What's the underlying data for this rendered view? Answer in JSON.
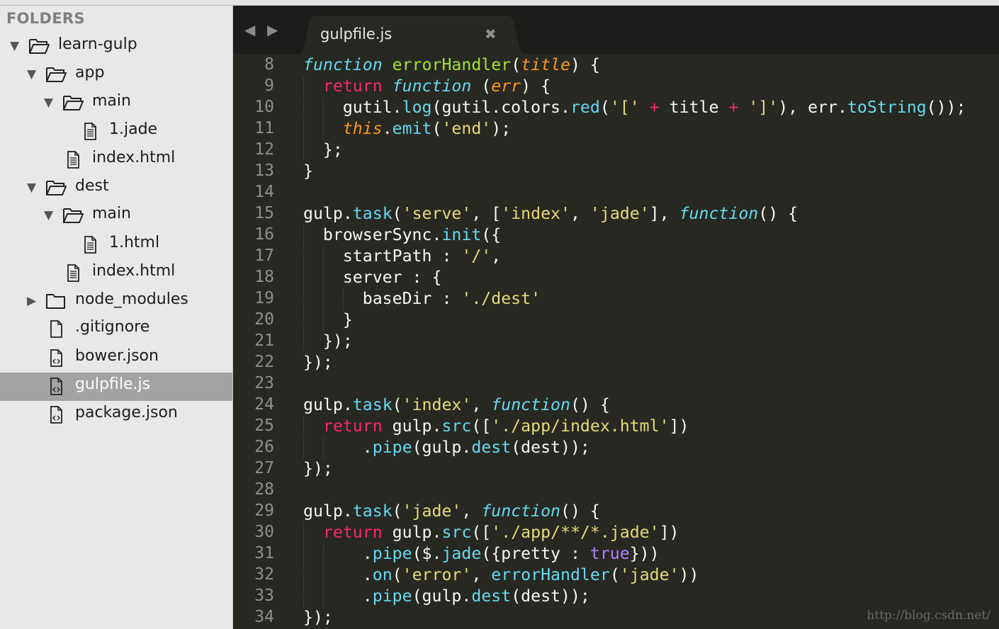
{
  "sidebar": {
    "title": "FOLDERS",
    "items": [
      {
        "label": "learn-gulp",
        "arrow": "▼",
        "icon": "folder-open-icon"
      },
      {
        "label": "app",
        "arrow": "▼",
        "icon": "folder-open-icon"
      },
      {
        "label": "main",
        "arrow": "▼",
        "icon": "folder-open-icon"
      },
      {
        "label": "1.jade",
        "arrow": "",
        "icon": "text-file-icon"
      },
      {
        "label": "index.html",
        "arrow": "",
        "icon": "text-file-icon"
      },
      {
        "label": "dest",
        "arrow": "▼",
        "icon": "folder-open-icon"
      },
      {
        "label": "main",
        "arrow": "▼",
        "icon": "folder-open-icon"
      },
      {
        "label": "1.html",
        "arrow": "",
        "icon": "text-file-icon"
      },
      {
        "label": "index.html",
        "arrow": "",
        "icon": "text-file-icon"
      },
      {
        "label": "node_modules",
        "arrow": "▶",
        "icon": "folder-closed-icon"
      },
      {
        "label": ".gitignore",
        "arrow": "",
        "icon": "blank-file-icon"
      },
      {
        "label": "bower.json",
        "arrow": "",
        "icon": "code-file-icon"
      },
      {
        "label": "gulpfile.js",
        "arrow": "",
        "icon": "code-file-icon",
        "selected": true
      },
      {
        "label": "package.json",
        "arrow": "",
        "icon": "code-file-icon"
      }
    ]
  },
  "tabbar": {
    "back_arrow": "◀",
    "forward_arrow": "▶",
    "tab_label": "gulpfile.js",
    "tab_close": "✖"
  },
  "editor": {
    "theme": {
      "background": "#272822",
      "storage": "#66d9ef",
      "entity": "#a6e22e",
      "parameter": "#fd971f",
      "keyword": "#f92672",
      "string": "#e6db74",
      "constant": "#ae81ff"
    },
    "line_numbers": [
      "8",
      "9",
      "10",
      "11",
      "12",
      "13",
      "14",
      "15",
      "16",
      "17",
      "18",
      "19",
      "20",
      "21",
      "22",
      "23",
      "24",
      "25",
      "26",
      "27",
      "28",
      "29",
      "30",
      "31",
      "32",
      "33",
      "34"
    ],
    "lines": [
      [
        {
          "t": "function",
          "c": "storage"
        },
        {
          "t": " "
        },
        {
          "t": "errorHandler",
          "c": "entity"
        },
        {
          "t": "("
        },
        {
          "t": "title",
          "c": "param"
        },
        {
          "t": ") {"
        }
      ],
      [
        {
          "t": "  "
        },
        {
          "t": "return",
          "c": "keyword"
        },
        {
          "t": " "
        },
        {
          "t": "function",
          "c": "storage"
        },
        {
          "t": " ("
        },
        {
          "t": "err",
          "c": "param"
        },
        {
          "t": ") {"
        }
      ],
      [
        {
          "t": "    gutil."
        },
        {
          "t": "log",
          "c": "support"
        },
        {
          "t": "(gutil.colors."
        },
        {
          "t": "red",
          "c": "support"
        },
        {
          "t": "("
        },
        {
          "t": "'['",
          "c": "string"
        },
        {
          "t": " "
        },
        {
          "t": "+",
          "c": "keyword"
        },
        {
          "t": " title "
        },
        {
          "t": "+",
          "c": "keyword"
        },
        {
          "t": " "
        },
        {
          "t": "']'",
          "c": "string"
        },
        {
          "t": "), err."
        },
        {
          "t": "toString",
          "c": "support"
        },
        {
          "t": "());"
        }
      ],
      [
        {
          "t": "    "
        },
        {
          "t": "this",
          "c": "param"
        },
        {
          "t": "."
        },
        {
          "t": "emit",
          "c": "support"
        },
        {
          "t": "("
        },
        {
          "t": "'end'",
          "c": "string"
        },
        {
          "t": ");"
        }
      ],
      [
        {
          "t": "  };"
        }
      ],
      [
        {
          "t": "}"
        }
      ],
      [
        {
          "t": ""
        }
      ],
      [
        {
          "t": "gulp."
        },
        {
          "t": "task",
          "c": "support"
        },
        {
          "t": "("
        },
        {
          "t": "'serve'",
          "c": "string"
        },
        {
          "t": ", ["
        },
        {
          "t": "'index'",
          "c": "string"
        },
        {
          "t": ", "
        },
        {
          "t": "'jade'",
          "c": "string"
        },
        {
          "t": "], "
        },
        {
          "t": "function",
          "c": "storage"
        },
        {
          "t": "() {"
        }
      ],
      [
        {
          "t": "  browserSync."
        },
        {
          "t": "init",
          "c": "support"
        },
        {
          "t": "({"
        }
      ],
      [
        {
          "t": "    startPath : "
        },
        {
          "t": "'/'",
          "c": "string"
        },
        {
          "t": ","
        }
      ],
      [
        {
          "t": "    server : {"
        }
      ],
      [
        {
          "t": "      baseDir : "
        },
        {
          "t": "'./dest'",
          "c": "string"
        }
      ],
      [
        {
          "t": "    }"
        }
      ],
      [
        {
          "t": "  });"
        }
      ],
      [
        {
          "t": "});"
        }
      ],
      [
        {
          "t": ""
        }
      ],
      [
        {
          "t": "gulp."
        },
        {
          "t": "task",
          "c": "support"
        },
        {
          "t": "("
        },
        {
          "t": "'index'",
          "c": "string"
        },
        {
          "t": ", "
        },
        {
          "t": "function",
          "c": "storage"
        },
        {
          "t": "() {"
        }
      ],
      [
        {
          "t": "  "
        },
        {
          "t": "return",
          "c": "keyword"
        },
        {
          "t": " gulp."
        },
        {
          "t": "src",
          "c": "support"
        },
        {
          "t": "(["
        },
        {
          "t": "'./app/index.html'",
          "c": "string"
        },
        {
          "t": "])"
        }
      ],
      [
        {
          "t": "      ."
        },
        {
          "t": "pipe",
          "c": "support"
        },
        {
          "t": "(gulp."
        },
        {
          "t": "dest",
          "c": "support"
        },
        {
          "t": "(dest));"
        }
      ],
      [
        {
          "t": "});"
        }
      ],
      [
        {
          "t": ""
        }
      ],
      [
        {
          "t": "gulp."
        },
        {
          "t": "task",
          "c": "support"
        },
        {
          "t": "("
        },
        {
          "t": "'jade'",
          "c": "string"
        },
        {
          "t": ", "
        },
        {
          "t": "function",
          "c": "storage"
        },
        {
          "t": "() {"
        }
      ],
      [
        {
          "t": "  "
        },
        {
          "t": "return",
          "c": "keyword"
        },
        {
          "t": " gulp."
        },
        {
          "t": "src",
          "c": "support"
        },
        {
          "t": "(["
        },
        {
          "t": "'./app/**/*.jade'",
          "c": "string"
        },
        {
          "t": "])"
        }
      ],
      [
        {
          "t": "      ."
        },
        {
          "t": "pipe",
          "c": "support"
        },
        {
          "t": "($."
        },
        {
          "t": "jade",
          "c": "support"
        },
        {
          "t": "({pretty : "
        },
        {
          "t": "true",
          "c": "constant"
        },
        {
          "t": "}))"
        }
      ],
      [
        {
          "t": "      ."
        },
        {
          "t": "on",
          "c": "support"
        },
        {
          "t": "("
        },
        {
          "t": "'error'",
          "c": "string"
        },
        {
          "t": ", "
        },
        {
          "t": "errorHandler",
          "c": "support"
        },
        {
          "t": "("
        },
        {
          "t": "'jade'",
          "c": "string"
        },
        {
          "t": "))"
        }
      ],
      [
        {
          "t": "      ."
        },
        {
          "t": "pipe",
          "c": "support"
        },
        {
          "t": "(gulp."
        },
        {
          "t": "dest",
          "c": "support"
        },
        {
          "t": "(dest));"
        }
      ],
      [
        {
          "t": "});"
        }
      ]
    ]
  },
  "watermark": "http://blog.csdn.net/"
}
